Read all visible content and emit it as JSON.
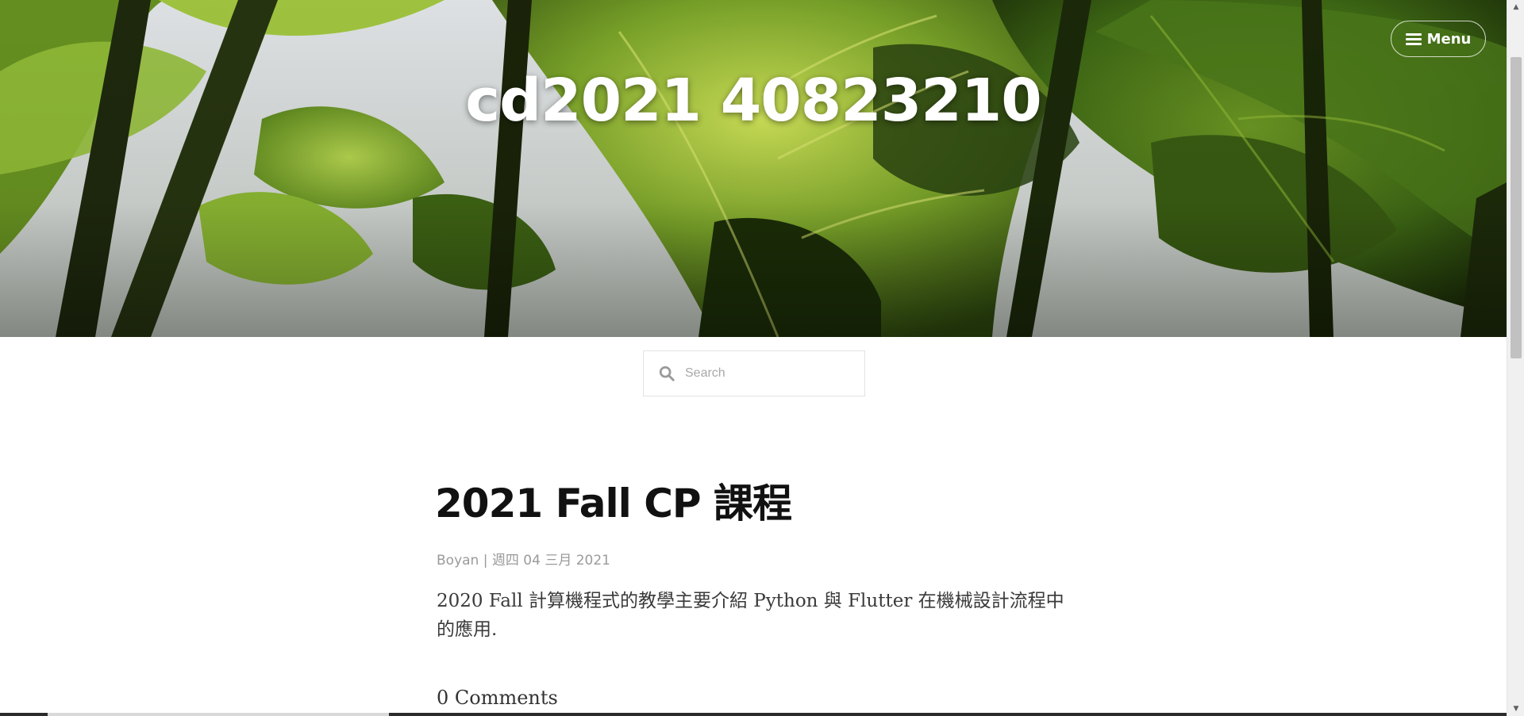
{
  "header": {
    "site_title": "cd2021 40823210",
    "menu_label": "Menu",
    "menu_icon": "hamburger-icon"
  },
  "search": {
    "placeholder": "Search",
    "icon": "search-icon"
  },
  "post": {
    "title": "2021 Fall CP 課程",
    "author": "Boyan",
    "separator": "|",
    "date": "週四 04 三月 2021",
    "excerpt": "2020 Fall 計算機程式的教學主要介紹 Python 與 Flutter 在機械設計流程中的應用.",
    "comments": "0 Comments"
  },
  "colors": {
    "hero_leaf_dark": "#2f4a10",
    "hero_leaf_light": "#9cc63a",
    "title_text": "#ffffff",
    "meta_text": "#9a9a9a"
  }
}
